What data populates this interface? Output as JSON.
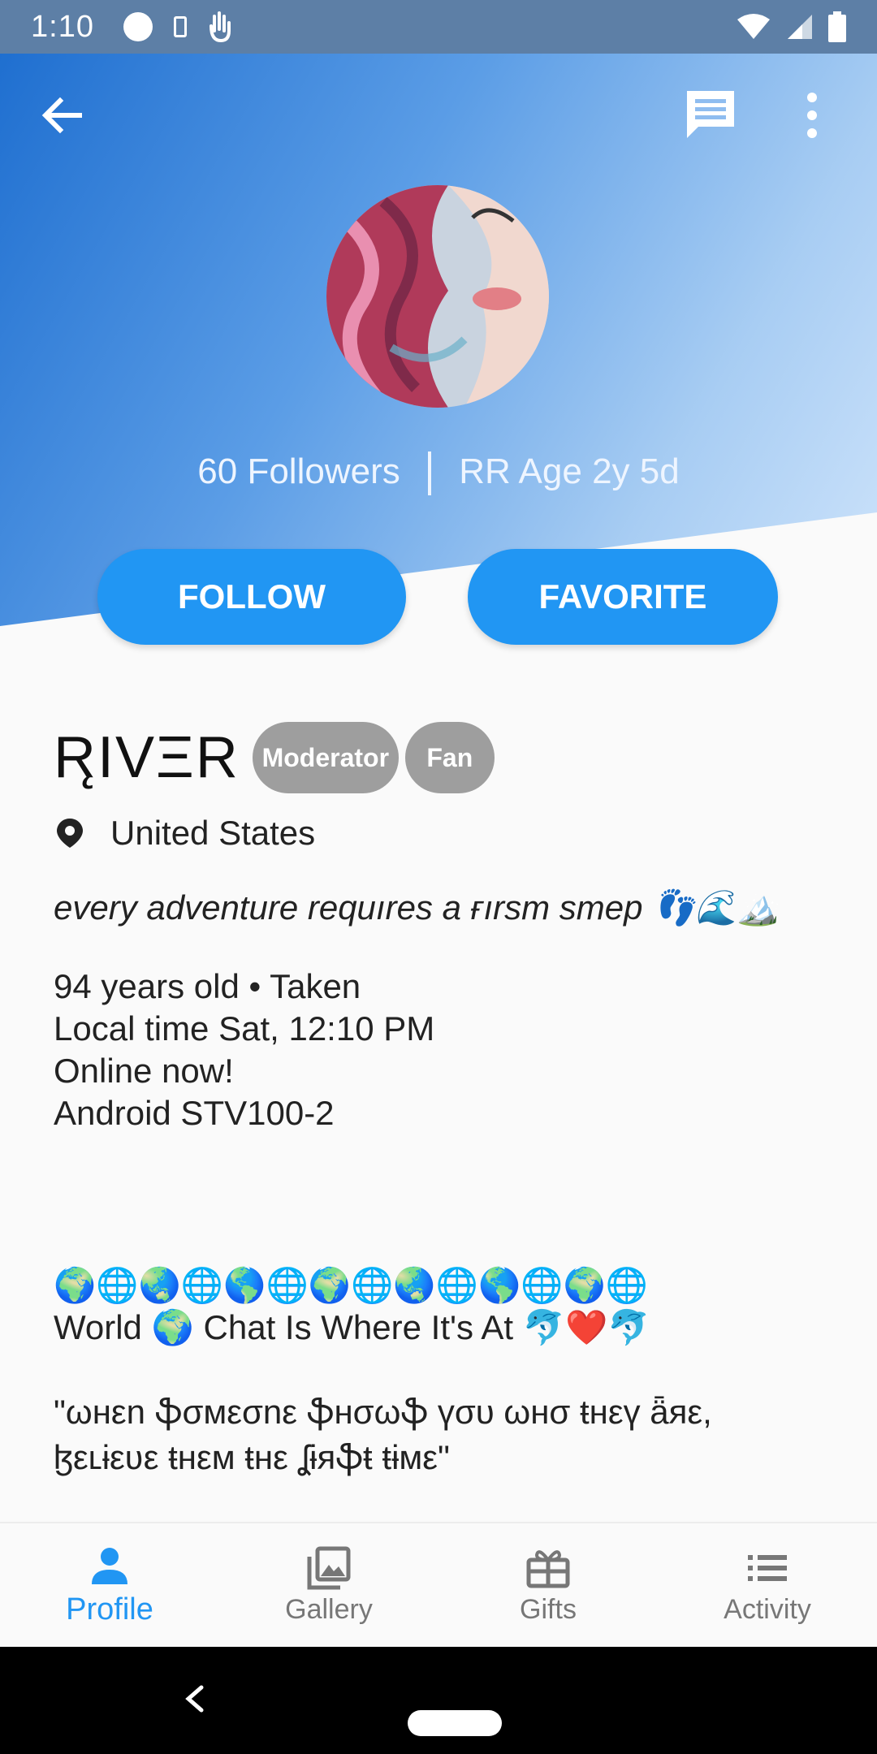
{
  "status_bar": {
    "time": "1:10",
    "icons": [
      "circle-icon",
      "phone-icon",
      "hand-icon",
      "wifi-icon",
      "signal-icon",
      "battery-icon"
    ]
  },
  "header": {
    "back_icon": "arrow-left-icon",
    "chat_icon": "message-icon",
    "more_icon": "more-vertical-icon",
    "followers": "60 Followers",
    "rr_age": "RR Age 2y 5d",
    "follow_label": "FOLLOW",
    "favorite_label": "FAVORITE",
    "accent": "#2196f3"
  },
  "profile": {
    "username": "R̨IVΞR",
    "badges": [
      "Moderator",
      "Fan"
    ],
    "location": "United States",
    "tagline": "every adventure requıres a ғırsт sтep 👣🌊🏔️",
    "age_status": "94 years old • Taken",
    "local_time": "Local time Sat, 12:10 PM",
    "online": "Online now!",
    "device": "Android STV100-2",
    "globes": "🌍🌐🌏🌐🌎🌐🌍🌐🌏🌐🌎🌐🌍🌐",
    "world_chat": "World 🌍 Chat Is Where It's At 🐬❤️🐬",
    "quote_line1": "\"ωнεn ֆσмεσnε ֆнσωֆ үσυ ωнσ ŧнεү ǟяε,",
    "quote_line2": "ɮεʟɨεʋε ŧнεм ŧнε ʆɨяֆŧ ŧɨмε\""
  },
  "bottom_nav": {
    "items": [
      {
        "label": "Profile",
        "icon": "person-icon",
        "active": true
      },
      {
        "label": "Gallery",
        "icon": "image-icon",
        "active": false
      },
      {
        "label": "Gifts",
        "icon": "gift-icon",
        "active": false
      },
      {
        "label": "Activity",
        "icon": "list-icon",
        "active": false
      }
    ]
  }
}
